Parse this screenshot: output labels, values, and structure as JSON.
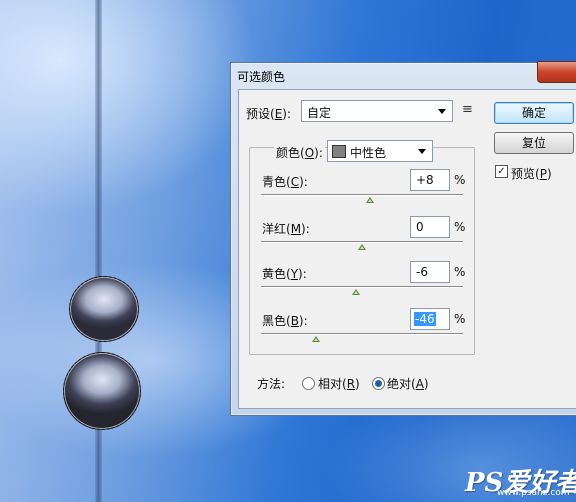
{
  "dialog": {
    "title": "可选颜色",
    "preset": {
      "label_before": "预设(",
      "hotkey": "E",
      "label_after": "):",
      "value": "自定"
    },
    "buttons": {
      "ok": "确定",
      "reset": "复位"
    },
    "preview": {
      "label_before": "预览(",
      "hotkey": "P",
      "label_after": ")",
      "checked": true
    },
    "colors": {
      "label_before": "颜色(",
      "hotkey": "O",
      "label_after": "):",
      "value": "中性色",
      "swatch": "#808080"
    },
    "sliders": [
      {
        "name": "cyan",
        "label_before": "青色(",
        "hotkey": "C",
        "label_after": "):",
        "value": "+8",
        "percent": "%",
        "level": 8
      },
      {
        "name": "magenta",
        "label_before": "洋红(",
        "hotkey": "M",
        "label_after": "):",
        "value": "0",
        "percent": "%",
        "level": 0
      },
      {
        "name": "yellow",
        "label_before": "黄色(",
        "hotkey": "Y",
        "label_after": "):",
        "value": "-6",
        "percent": "%",
        "level": -6
      },
      {
        "name": "black",
        "label_before": "黑色(",
        "hotkey": "B",
        "label_after": "):",
        "value": "-46",
        "percent": "%",
        "level": -46
      }
    ],
    "method": {
      "label": "方法:",
      "relative": {
        "label_before": "相对(",
        "hotkey": "R",
        "label_after": ")",
        "selected": false
      },
      "absolute": {
        "label_before": "绝对(",
        "hotkey": "A",
        "label_after": ")",
        "selected": true
      }
    }
  },
  "watermark": {
    "main": "PS爱好者",
    "sub": "www.psahz.com"
  }
}
